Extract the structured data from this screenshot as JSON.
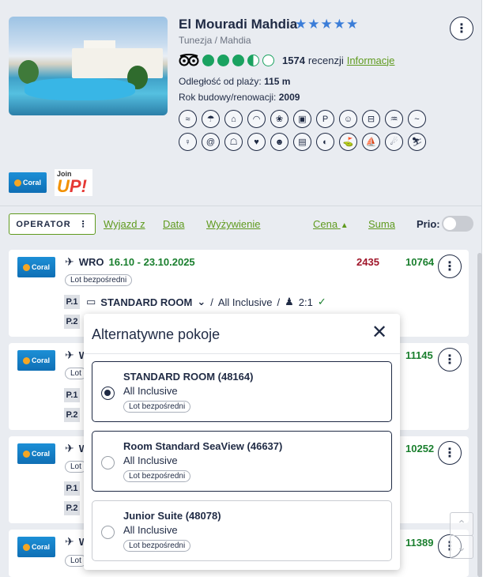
{
  "hotel": {
    "name": "El Mouradi Mahdia",
    "stars": "★★★★★",
    "location": "Tunezja / Mahdia",
    "review_count": "1574",
    "review_label": "recenzji",
    "info_link": "Informacje",
    "beach_label": "Odległość od plaży:",
    "beach_value": "115 m",
    "built_label": "Rok budowy/renowacji:",
    "built_value": "2009",
    "tripadvisor_rating": 3.5,
    "amenities": [
      "beach-icon",
      "umbrella-icon",
      "restaurant-icon",
      "wifi-icon",
      "spa-icon",
      "tv-icon",
      "parking-icon",
      "kids-club-icon",
      "gym-icon",
      "pool-icon",
      "swimming-icon",
      "animation-icon",
      "internet-icon",
      "bar-icon",
      "drinks-icon",
      "theatre-icon",
      "cinema-icon",
      "tennis-icon",
      "golf-icon",
      "windsurf-icon",
      "diving-icon",
      "ski-icon"
    ],
    "amenity_glyphs": [
      "≈",
      "☂",
      "⌂",
      "◠",
      "❀",
      "▣",
      "P",
      "☺",
      "⊟",
      "♒",
      "~",
      "♀",
      "@",
      "☖",
      "♥",
      "☻",
      "▤",
      "◐",
      "⛳",
      "⛵",
      "☄",
      "⛷"
    ]
  },
  "logos": {
    "coral": "Coral",
    "joinup_small": "Join",
    "joinup_big": "U",
    "joinup_big2": "P!"
  },
  "sortbar": {
    "operator": "OPERATOR",
    "operator_icon": "⋮",
    "departure": "Wyjazd z",
    "date": "Data",
    "board": "Wyżywienie",
    "price": "Cena",
    "price_arrow": "▲",
    "total": "Suma",
    "prio": "Prio:"
  },
  "offers": [
    {
      "origin": "WRO",
      "dates": "16.10 - 23.10.2025",
      "price": "2435",
      "total": "10764",
      "flight_tag": "Lot bezpośredni",
      "p1": "P.1",
      "p2": "P.2",
      "room": "STANDARD ROOM",
      "board": "All Inclusive",
      "occupancy": "2:1"
    },
    {
      "origin": "W",
      "total": "11145",
      "flight_tag": "Lot",
      "p1": "P.1",
      "p2": "P.2"
    },
    {
      "origin": "W",
      "total": "10252",
      "flight_tag": "Lot",
      "p1": "P.1",
      "p2": "P.2"
    },
    {
      "origin": "W",
      "total": "11389",
      "flight_tag": "Lot"
    }
  ],
  "modal": {
    "title": "Alternatywne pokoje",
    "close": "✕",
    "options": [
      {
        "name": "STANDARD ROOM (48164)",
        "board": "All Inclusive",
        "tag": "Lot bezpośredni",
        "selected": true
      },
      {
        "name": "Room Standard SeaView (46637)",
        "board": "All Inclusive",
        "tag": "Lot bezpośredni",
        "selected": false
      },
      {
        "name": "Junior Suite (48078)",
        "board": "All Inclusive",
        "tag": "Lot bezpośredni",
        "selected": false
      }
    ]
  },
  "icons": {
    "more": "⋮",
    "plane": "✈",
    "bed": "▭",
    "chevron": "⌄",
    "person": "♟",
    "check": "✓",
    "up": "⌃",
    "down": "⌄"
  },
  "colors": {
    "accent_green": "#5f9a1e",
    "price_red": "#a0162a",
    "total_green": "#1a7f2e",
    "navy": "#1f2a44",
    "star_blue": "#3b7dd8"
  }
}
